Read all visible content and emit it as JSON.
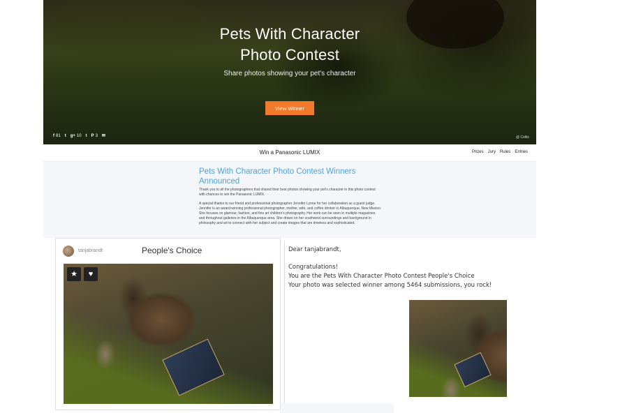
{
  "hero": {
    "title_line1": "Pets With Character",
    "title_line2": "Photo Contest",
    "subtitle": "Share photos showing your pet's character",
    "cta_label": "View Winner",
    "photo_credit": "@ Celtic",
    "social": [
      {
        "icon": "facebook-icon",
        "glyph": "f",
        "count": "81"
      },
      {
        "icon": "twitter-icon",
        "glyph": "🐦",
        "count": ""
      },
      {
        "icon": "google-plus-icon",
        "glyph": "g+",
        "count": "10"
      },
      {
        "icon": "tumblr-icon",
        "glyph": "t",
        "count": ""
      },
      {
        "icon": "pinterest-icon",
        "glyph": "P",
        "count": "3"
      },
      {
        "icon": "email-icon",
        "glyph": "✉",
        "count": ""
      }
    ]
  },
  "nav": {
    "title": "Win a Panasonic LUMIX",
    "links": [
      "Prizes",
      "Jury",
      "Rules",
      "Entries"
    ]
  },
  "article": {
    "title": "Pets With Character Photo Contest Winners Announced",
    "p1": "Thank you to all the photographers that shared their best photos showing your pet's character in this photo contest with chances to win the Panasonic LUMIX.",
    "p2": "A special thanks to our friend and professional photographer Jennifer Lynne for her collaboration as a guest judge. Jennifer is an award-winning professional photographer, mother, wife, and coffee drinker in Albuquerque, New Mexico. She focuses on glamour, fashion, and fine art children's photography. Her work can be seen in multiple magazines and throughout galleries in the Albuquerque area. She draws on her southwest surroundings and background in philosophy and art to connect with her subject and create images that are timeless and sophisticated."
  },
  "card": {
    "username": "tanjabrandt",
    "title": "People's Choice",
    "star_glyph": "★",
    "heart_glyph": "♥"
  },
  "email": {
    "greeting": "Dear tanjabrandt,",
    "line1": "Congratulations!",
    "line2": "You are the Pets With Character Photo Contest People's Choice",
    "line3": "Your photo was selected winner among 5464 submissions, you rock!"
  }
}
